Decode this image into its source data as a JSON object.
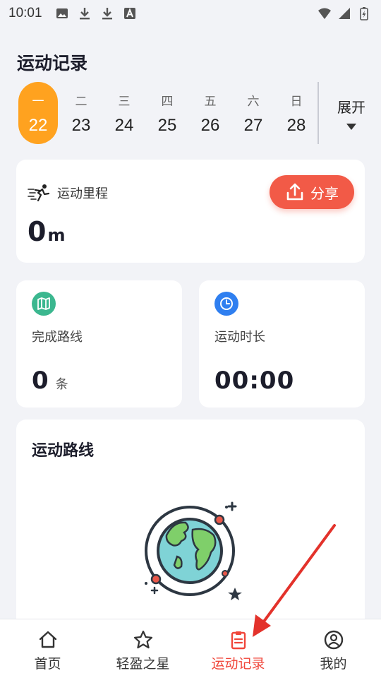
{
  "status_bar": {
    "time": "10:01"
  },
  "page_title": "运动记录",
  "week": {
    "days": [
      {
        "weekday": "一",
        "date": "22",
        "active": true
      },
      {
        "weekday": "二",
        "date": "23",
        "active": false
      },
      {
        "weekday": "三",
        "date": "24",
        "active": false
      },
      {
        "weekday": "四",
        "date": "25",
        "active": false
      },
      {
        "weekday": "五",
        "date": "26",
        "active": false
      },
      {
        "weekday": "六",
        "date": "27",
        "active": false
      },
      {
        "weekday": "日",
        "date": "28",
        "active": false
      }
    ],
    "expand_label": "展开"
  },
  "distance_card": {
    "label": "运动里程",
    "value": "0",
    "unit": "m",
    "share_label": "分享"
  },
  "route_card": {
    "label": "完成路线",
    "value": "0",
    "unit": "条"
  },
  "duration_card": {
    "label": "运动时长",
    "value": "00:00"
  },
  "map_card": {
    "title": "运动路线"
  },
  "tabbar": {
    "items": [
      {
        "label": "首页",
        "icon": "home-icon"
      },
      {
        "label": "轻盈之星",
        "icon": "star-icon"
      },
      {
        "label": "运动记录",
        "icon": "clipboard-icon",
        "active": true
      },
      {
        "label": "我的",
        "icon": "user-icon"
      }
    ]
  },
  "colors": {
    "accent_orange": "#ffa21f",
    "share_red": "#f25a47",
    "active_tab": "#f0463a",
    "route_green": "#3bb78f",
    "clock_blue": "#2f7ff0"
  }
}
